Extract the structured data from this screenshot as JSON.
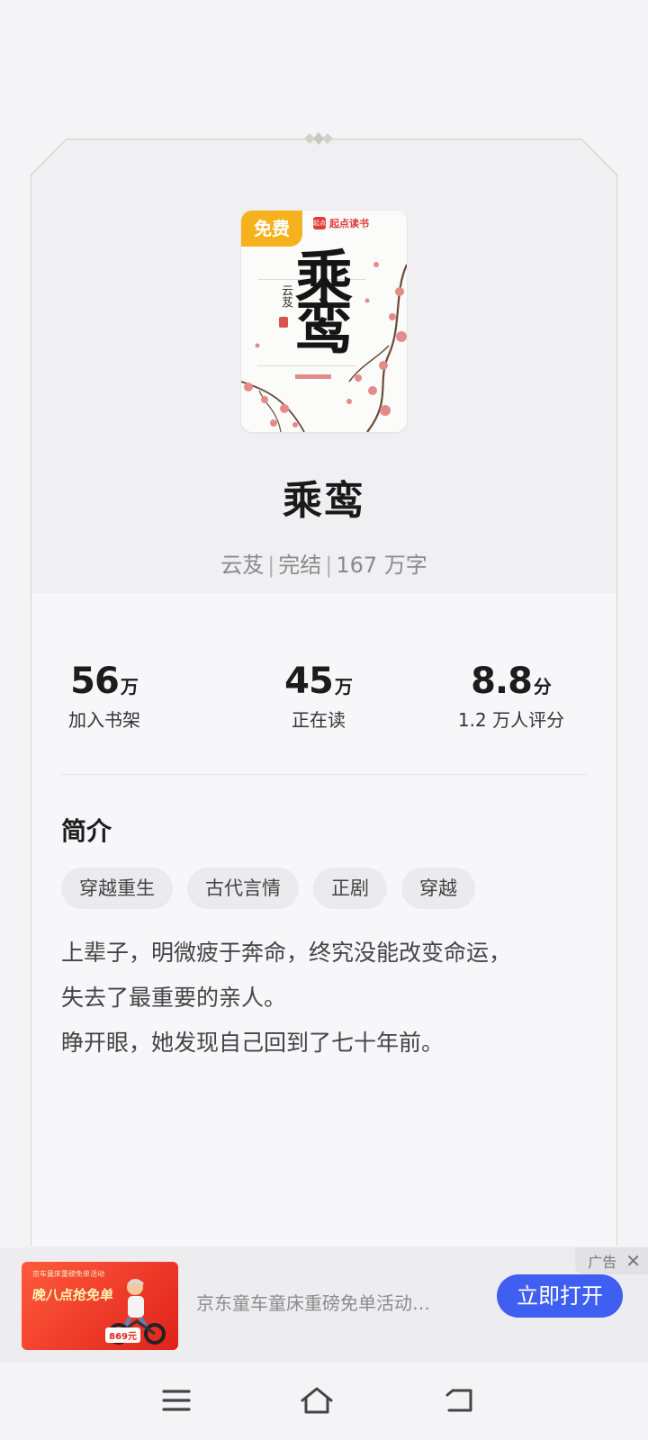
{
  "book": {
    "cover": {
      "free_badge": "免费",
      "publisher": "起点读书",
      "publisher_logo": "起点",
      "cover_title": "乘鸾",
      "cover_author": "云芨"
    },
    "title": "乘鸾",
    "author": "云芨",
    "status": "完结",
    "word_count": "167 万字",
    "separator": "|"
  },
  "stats": [
    {
      "value": "56",
      "unit": "万",
      "label": "加入书架"
    },
    {
      "value": "45",
      "unit": "万",
      "label": "正在读"
    },
    {
      "value": "8.8",
      "unit": "分",
      "label": "1.2 万人评分"
    }
  ],
  "intro": {
    "heading": "简介",
    "tags": [
      "穿越重生",
      "古代言情",
      "正剧",
      "穿越"
    ],
    "lines": [
      "上辈子，明微疲于奔命，终究没能改变命运，",
      "失去了最重要的亲人。",
      "睁开眼，她发现自己回到了七十年前。"
    ]
  },
  "ad": {
    "label": "广告",
    "close": "✕",
    "image_small": "京车童床重磅免单活动",
    "image_title": "晚八点抢免单",
    "image_price": "869元",
    "text": "京东童车童床重磅免单活动…",
    "button": "立即打开"
  },
  "nav": {
    "icons": [
      "menu-icon",
      "home-icon",
      "back-icon"
    ]
  },
  "colors": {
    "accent": "#3f5ef2",
    "badge": "#f5b21c",
    "publisher": "#e33a3a"
  }
}
